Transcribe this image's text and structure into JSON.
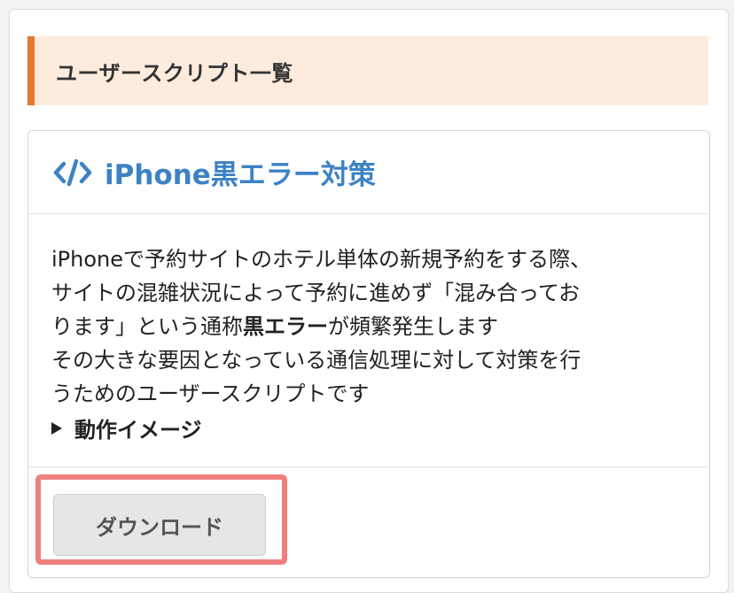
{
  "section": {
    "title": "ユーザースクリプト一覧",
    "accent_color": "#e8762c",
    "background_color": "#fdecdd"
  },
  "card": {
    "icon": "code-icon",
    "title": "iPhone黒エラー対策",
    "title_color": "#3d82c4",
    "description": {
      "line1": "iPhoneで予約サイトのホテル単体の新規予約をする際、",
      "line2": "サイトの混雑状況によって予約に進めず「混み合ってお",
      "line3_before": "ります」という通称",
      "line3_bold": "黒エラー",
      "line3_after": "が頻繁発生します",
      "line4": "その大きな要因となっている通信処理に対して対策を行",
      "line5": "うためのユーザースクリプトです"
    },
    "details_label": "動作イメージ",
    "download_label": "ダウンロード"
  },
  "highlight_color": "#f08080"
}
